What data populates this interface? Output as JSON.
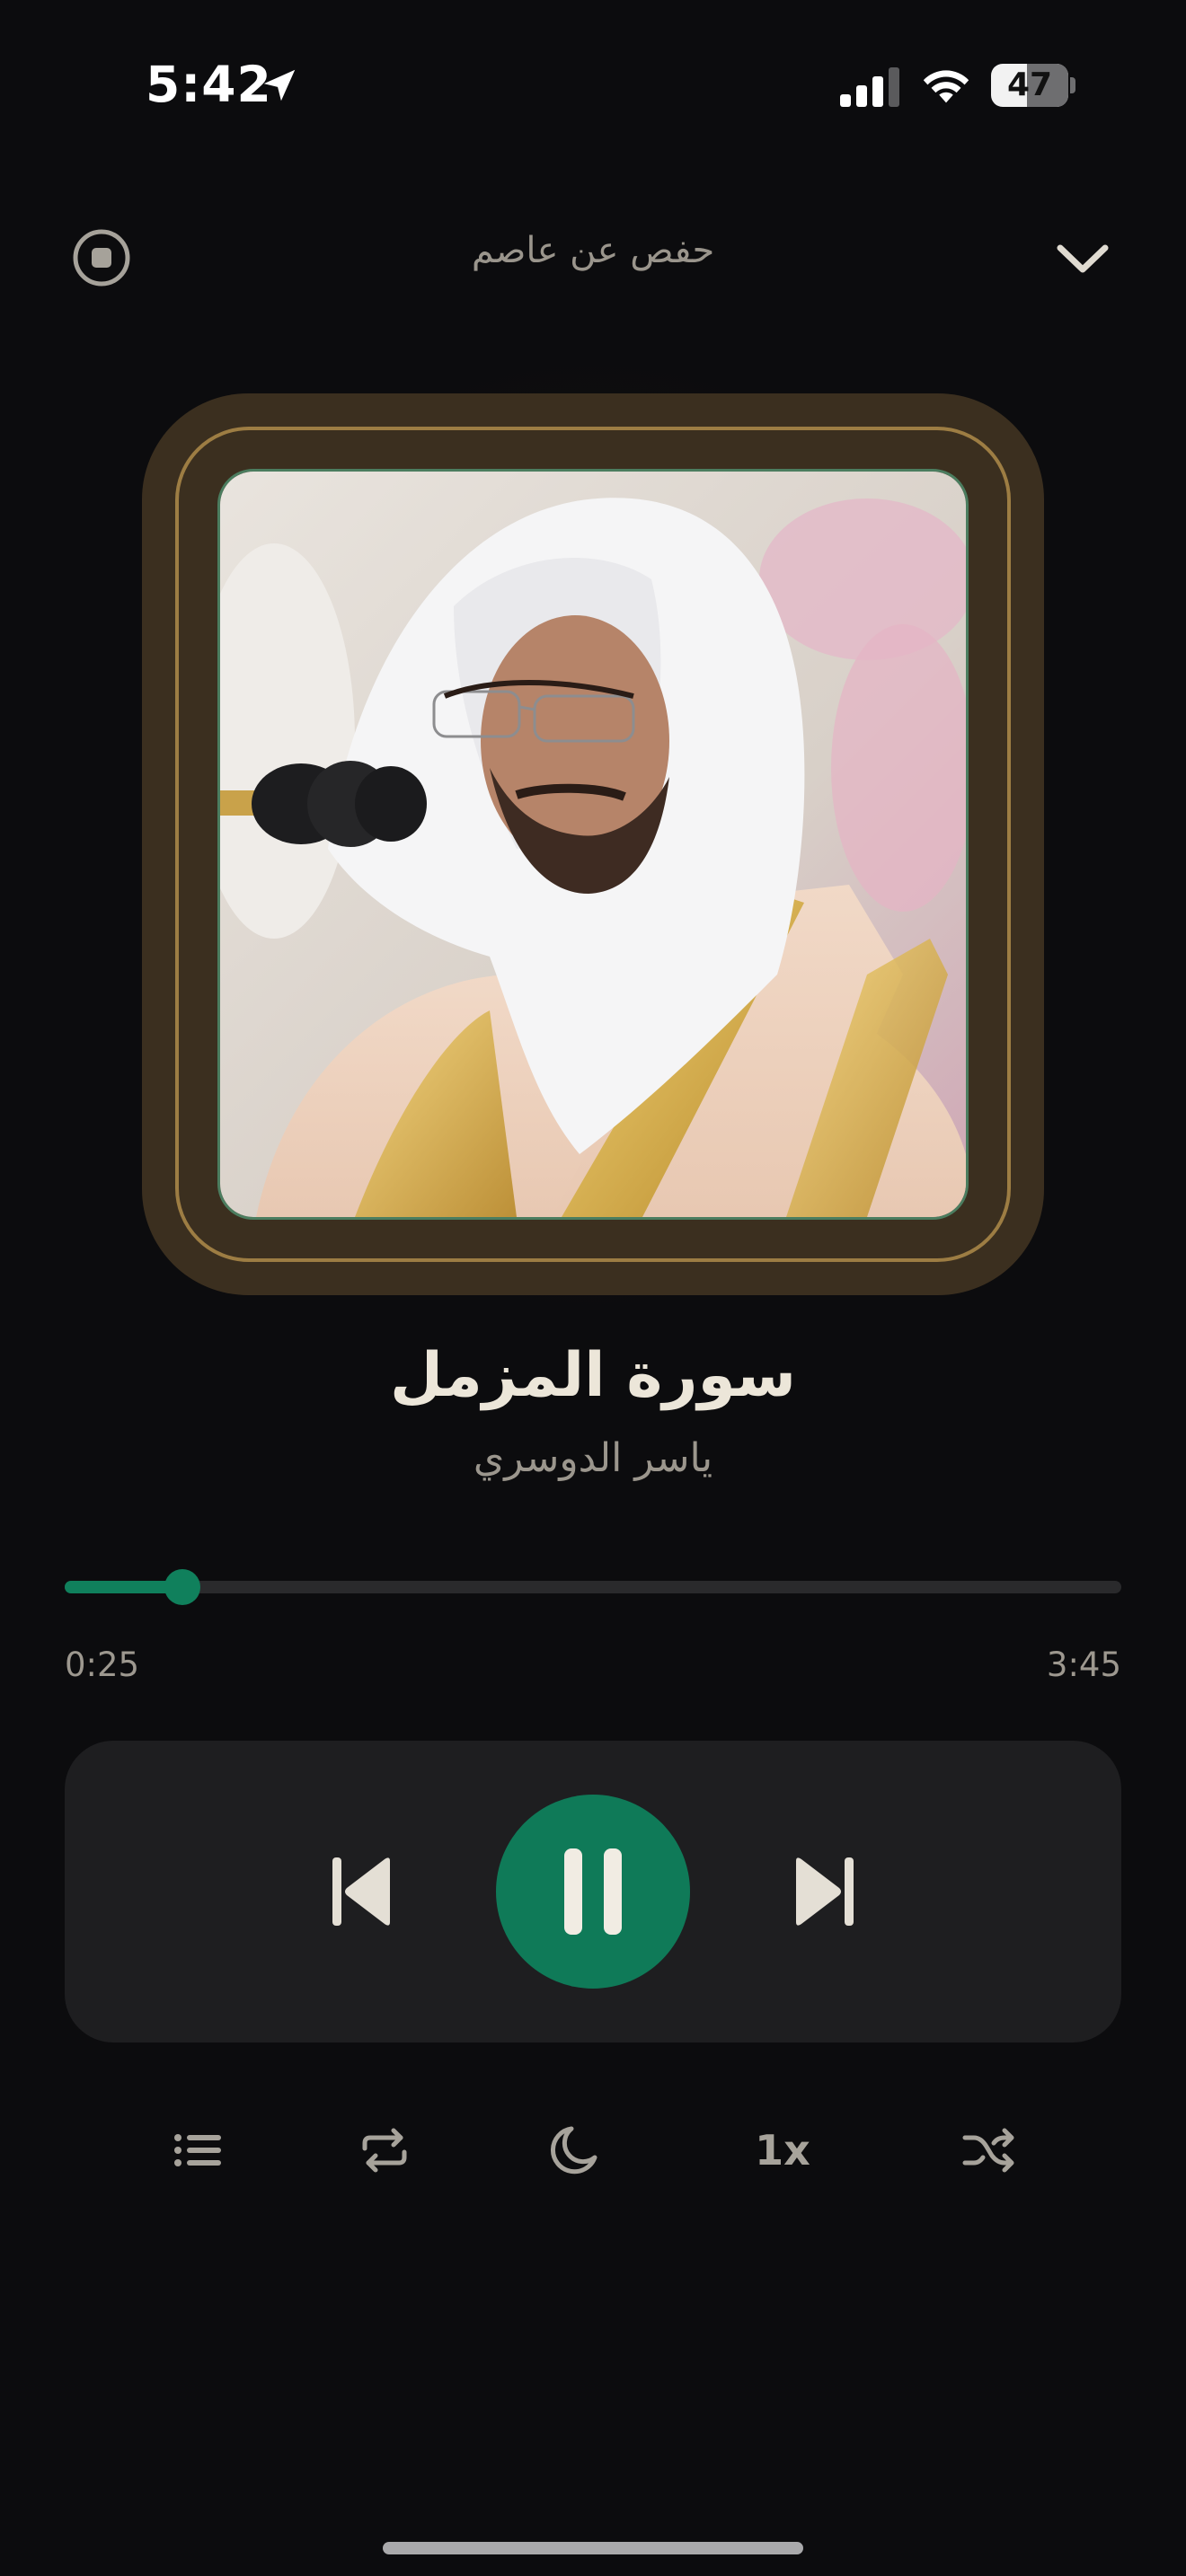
{
  "status_bar": {
    "time": "5:42",
    "battery_level": "47",
    "icons": [
      "location-arrow-icon",
      "cellular-signal-icon",
      "wifi-icon",
      "battery-icon"
    ]
  },
  "header": {
    "title": "حفص عن عاصم",
    "left_icon": "stop-circle-icon",
    "right_icon": "chevron-down-icon"
  },
  "now_playing": {
    "surah_name": "سورة المزمل",
    "reciter": "ياسر الدوسري",
    "artwork": "reciter-portrait"
  },
  "progress": {
    "current_time": "0:25",
    "total_time": "3:45",
    "fraction": 0.111
  },
  "controls": {
    "icons": [
      "skip-previous-icon",
      "pause-icon",
      "skip-next-icon"
    ]
  },
  "bottom_bar": {
    "speed_label": "1x",
    "icons": [
      "playlist-icon",
      "repeat-icon",
      "sleep-timer-moon-icon",
      "shuffle-icon"
    ]
  },
  "colors": {
    "background": "#0c0c0e",
    "accent": "#0f7a58",
    "frame_gold": "#9d7d43",
    "frame_brown": "#3b2f1f",
    "controls_panel": "#1e1e20"
  }
}
